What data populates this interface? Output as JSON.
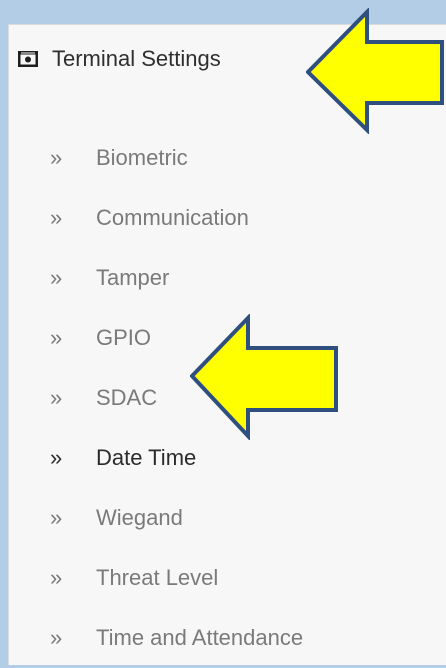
{
  "header": {
    "title": "Terminal Settings",
    "icon": "camera-icon"
  },
  "menu": {
    "chevron": "»",
    "active_index": 5,
    "items": [
      {
        "label": "Biometric"
      },
      {
        "label": "Communication"
      },
      {
        "label": "Tamper"
      },
      {
        "label": "GPIO"
      },
      {
        "label": "SDAC"
      },
      {
        "label": "Date Time"
      },
      {
        "label": "Wiegand"
      },
      {
        "label": "Threat Level"
      },
      {
        "label": "Time and Attendance"
      }
    ]
  },
  "colors": {
    "background": "#b3cde6",
    "panel": "#f7f7f7",
    "menu_text": "#7a7a7a",
    "active_text": "#2b2b2b",
    "arrow_fill": "#ffff00",
    "arrow_stroke": "#2f4f7f"
  }
}
